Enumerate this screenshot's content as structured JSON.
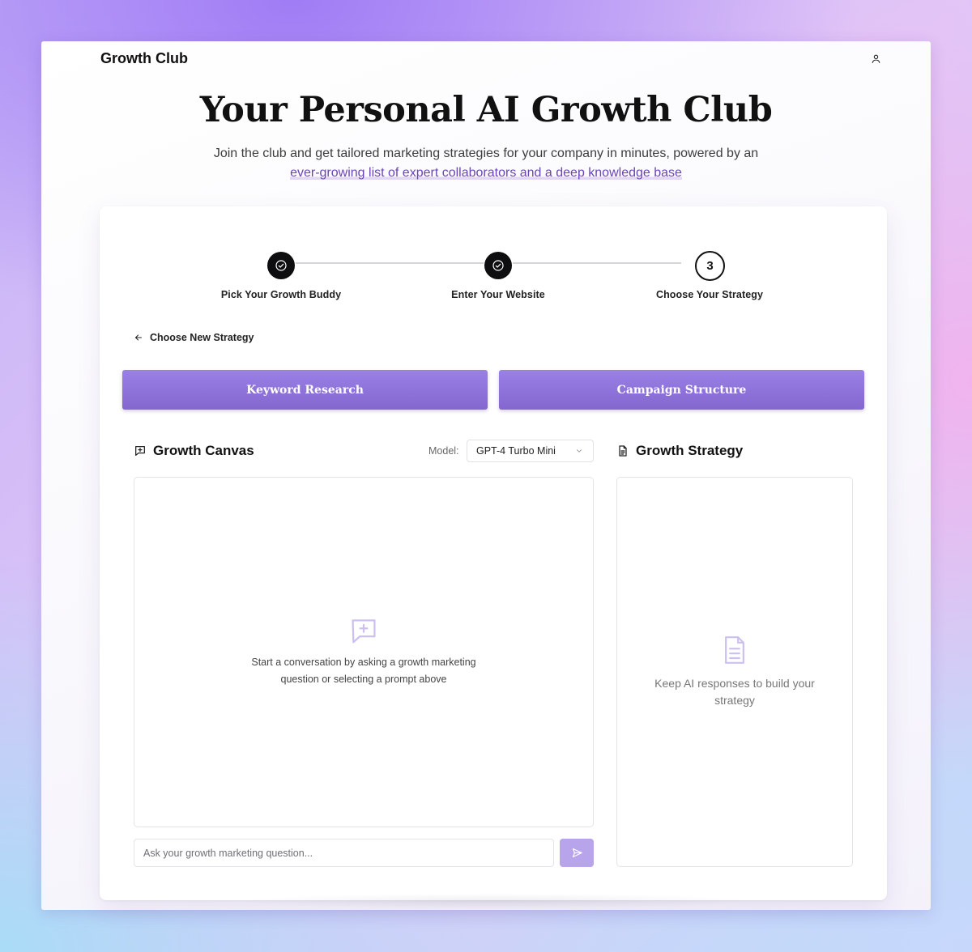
{
  "app": {
    "brand": "Growth Club"
  },
  "hero": {
    "title": "Your Personal AI Growth Club",
    "subtitle_prefix": "Join the club and get tailored marketing strategies for your company in minutes, powered by an ",
    "subtitle_link": "ever-growing list of expert collaborators and a deep knowledge base"
  },
  "stepper": {
    "steps": [
      {
        "label": "Pick Your Growth Buddy",
        "status": "complete"
      },
      {
        "label": "Enter Your Website",
        "status": "complete"
      },
      {
        "label": "Choose Your Strategy",
        "status": "active",
        "number": "3"
      }
    ]
  },
  "back_link": {
    "label": "Choose New Strategy",
    "icon": "arrow-left-icon"
  },
  "prompts": [
    {
      "label": "Keyword Research"
    },
    {
      "label": "Campaign Structure"
    }
  ],
  "canvas": {
    "title": "Growth Canvas",
    "icon": "message-plus-icon",
    "model_label": "Model:",
    "model_value": "GPT-4 Turbo Mini",
    "empty_line1": "Start a conversation by asking a growth marketing",
    "empty_line2": "question or selecting a prompt above",
    "input_placeholder": "Ask your growth marketing question...",
    "input_value": ""
  },
  "strategy": {
    "title": "Growth Strategy",
    "icon": "document-icon",
    "empty_line1": "Keep AI responses to build your",
    "empty_line2": "strategy"
  },
  "colors": {
    "accent": "#8a6dd9",
    "accent_light": "#b8a4ea",
    "link": "#6b45b8",
    "step_complete": "#0e0e10"
  }
}
